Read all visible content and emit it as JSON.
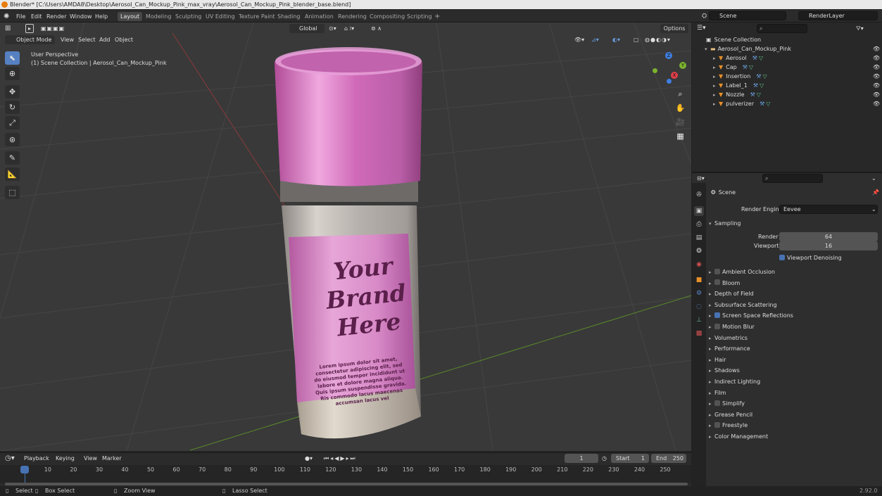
{
  "window": {
    "title": "Blender* [C:\\Users\\AMDA8\\Desktop\\Aerosol_Can_Mockup_Pink_max_vray\\Aerosol_Can_Mockup_Pink_blender_base.blend]"
  },
  "menu": [
    "File",
    "Edit",
    "Render",
    "Window",
    "Help"
  ],
  "workspaces": [
    "Layout",
    "Modeling",
    "Sculpting",
    "UV Editing",
    "Texture Paint",
    "Shading",
    "Animation",
    "Rendering",
    "Compositing",
    "Scripting"
  ],
  "workspaces_add": "+",
  "scene": {
    "name": "Scene",
    "view_layer": "RenderLayer"
  },
  "viewport": {
    "mode": "Object Mode",
    "menus": [
      "View",
      "Select",
      "Add",
      "Object"
    ],
    "orientation": "Global",
    "options_label": "Options",
    "perspective_label": "User Perspective",
    "collection_label": "(1) Scene Collection | Aerosol_Can_Mockup_Pink",
    "label_text": [
      "Your",
      "Brand",
      "Here"
    ],
    "lorem": "Lorem ipsum dolor sit amet, consectetur adipiscing elit, sed do eiusmod tempor incididunt ut labore et dolore magna aliqua. Quis ipsum suspendisse gravida. Ris commodo lacus maecenas accumsan lacus vel",
    "gizmo": {
      "x": "X",
      "y": "Y",
      "z": "Z"
    }
  },
  "outliner": {
    "root": "Scene Collection",
    "collection": "Aerosol_Can_Mockup_Pink",
    "objects": [
      "Aerosol",
      "Cap",
      "Insertion",
      "Label_1",
      "Nozzle",
      "pulverizer"
    ]
  },
  "properties": {
    "context": "Scene",
    "render_engine_label": "Render Engine",
    "render_engine": "Eevee",
    "sampling": {
      "title": "Sampling",
      "render_label": "Render",
      "render": "64",
      "viewport_label": "Viewport",
      "viewport": "16",
      "denoise_label": "Viewport Denoising"
    },
    "panels": [
      {
        "label": "Ambient Occlusion",
        "checkbox": true,
        "checked": false
      },
      {
        "label": "Bloom",
        "checkbox": true,
        "checked": false
      },
      {
        "label": "Depth of Field",
        "checkbox": false
      },
      {
        "label": "Subsurface Scattering",
        "checkbox": false
      },
      {
        "label": "Screen Space Reflections",
        "checkbox": true,
        "checked": true
      },
      {
        "label": "Motion Blur",
        "checkbox": true,
        "checked": false
      },
      {
        "label": "Volumetrics",
        "checkbox": false
      },
      {
        "label": "Performance",
        "checkbox": false
      },
      {
        "label": "Hair",
        "checkbox": false
      },
      {
        "label": "Shadows",
        "checkbox": false
      },
      {
        "label": "Indirect Lighting",
        "checkbox": false
      },
      {
        "label": "Film",
        "checkbox": false
      },
      {
        "label": "Simplify",
        "checkbox": true,
        "checked": false
      },
      {
        "label": "Grease Pencil",
        "checkbox": false
      },
      {
        "label": "Freestyle",
        "checkbox": true,
        "checked": false
      },
      {
        "label": "Color Management",
        "checkbox": false
      }
    ]
  },
  "timeline": {
    "menus": [
      "Playback",
      "Keying",
      "View",
      "Marker"
    ],
    "current_frame": "1",
    "start_label": "Start",
    "start": "1",
    "end_label": "End",
    "end": "250",
    "ticks": [
      "1",
      "10",
      "20",
      "30",
      "40",
      "50",
      "60",
      "70",
      "80",
      "90",
      "100",
      "110",
      "120",
      "130",
      "140",
      "150",
      "160",
      "170",
      "180",
      "190",
      "200",
      "210",
      "220",
      "230",
      "240",
      "250"
    ]
  },
  "status": {
    "select": "Select",
    "box_select": "Box Select",
    "zoom_view": "Zoom View",
    "lasso_select": "Lasso Select",
    "version": "2.92.0"
  },
  "colors": {
    "accent": "#4772b3",
    "can_pink": "#d271b9",
    "label_text": "#5a1f4a",
    "grid": "#454545"
  }
}
